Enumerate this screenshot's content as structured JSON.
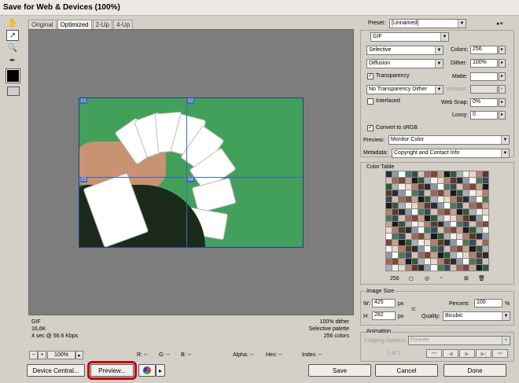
{
  "window": {
    "title": "Save for Web & Devices (100%)"
  },
  "tabs": [
    "Original",
    "Optimized",
    "2-Up",
    "4-Up"
  ],
  "slices": [
    "01",
    "02",
    "03",
    "04"
  ],
  "image_info": {
    "format": "GIF",
    "size": "16,6K",
    "speed": "4 sec @ 56.6 Kbps",
    "dither": "100% dither",
    "palette": "Selective palette",
    "colors": "256 colors"
  },
  "status": {
    "zoom": "100%",
    "r": "R: --",
    "g": "G: --",
    "b": "B: --",
    "alpha": "Alpha: --",
    "hex": "Hex: --",
    "index": "Index: --"
  },
  "buttons": {
    "device_central": "Device Central...",
    "preview": "Preview...",
    "save": "Save",
    "cancel": "Cancel",
    "done": "Done"
  },
  "settings": {
    "preset_label": "Preset:",
    "preset_value": "[Unnamed]",
    "format": "GIF",
    "reduction": "Selective",
    "colors_label": "Colors:",
    "colors_value": "256",
    "dither_algo": "Diffusion",
    "dither_label": "Dither:",
    "dither_value": "100%",
    "transparency_label": "Transparency",
    "matte_label": "Matte:",
    "trans_dither": "No Transparency Dither",
    "amount_label": "Amount:",
    "interlaced_label": "Interlaced",
    "websnap_label": "Web Snap:",
    "websnap_value": "0%",
    "lossy_label": "Lossy:",
    "lossy_value": "0",
    "convert_label": "Convert to sRGB",
    "preview_label": "Preview:",
    "preview_value": "Monitor Color",
    "metadata_label": "Metadata:",
    "metadata_value": "Copyright and Contact Info"
  },
  "color_table": {
    "title": "Color Table",
    "count": "256"
  },
  "image_size": {
    "title": "Image Size",
    "w_label": "W:",
    "w_value": "425",
    "h_label": "H:",
    "h_value": "282",
    "unit": "px",
    "percent_label": "Percent:",
    "percent_value": "100",
    "percent_unit": "%",
    "quality_label": "Quality:",
    "quality_value": "Bicubic"
  },
  "animation": {
    "title": "Animation",
    "looping_label": "Looping Options:",
    "looping_value": "Forever",
    "frame": "1 of 1"
  }
}
